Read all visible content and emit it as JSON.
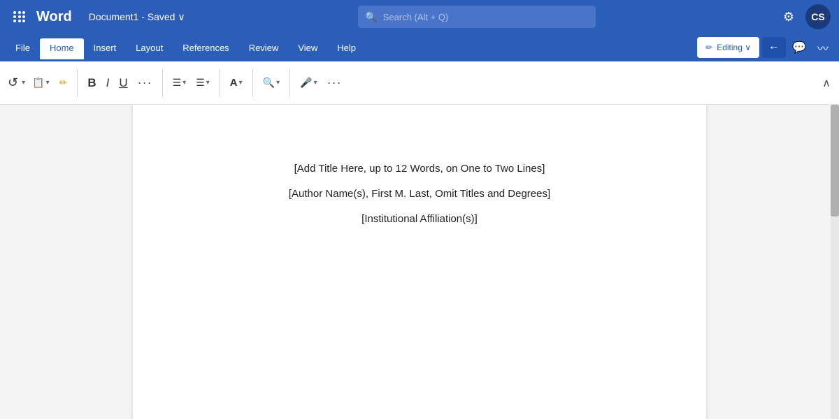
{
  "titlebar": {
    "grid_icon": "⋮⋮⋮",
    "app_name": "Word",
    "doc_title": "Document1  -  Saved  ∨",
    "search_placeholder": "Search (Alt + Q)",
    "settings_icon": "⚙",
    "avatar_initials": "CS"
  },
  "menubar": {
    "items": [
      {
        "label": "File",
        "active": false
      },
      {
        "label": "Home",
        "active": true
      },
      {
        "label": "Insert",
        "active": false
      },
      {
        "label": "Layout",
        "active": false
      },
      {
        "label": "References",
        "active": false
      },
      {
        "label": "Review",
        "active": false
      },
      {
        "label": "View",
        "active": false
      },
      {
        "label": "Help",
        "active": false
      }
    ],
    "edit_btn_label": "✏ Editing ∨",
    "share_icon": "↑",
    "comment_icon": "💬",
    "activity_icon": "~"
  },
  "ribbon": {
    "undo": "↺",
    "undo_dropdown": "∨",
    "redo": "↻",
    "clipboard": "📋",
    "clipboard_dropdown": "∨",
    "format_painter": "✏",
    "bold": "B",
    "italic": "I",
    "underline": "U",
    "more": "···",
    "list_bullet": "≡",
    "list_bullet_dropdown": "∨",
    "list_align": "≡",
    "list_align_dropdown": "∨",
    "font_color": "A",
    "font_color_dropdown": "∨",
    "find": "🔍",
    "find_dropdown": "∨",
    "mic": "🎤",
    "mic_dropdown": "∨",
    "extra": "···",
    "collapse": "∧"
  },
  "document": {
    "lines": [
      "[Add Title Here, up to 12 Words, on One to Two Lines]",
      "[Author Name(s), First M. Last, Omit Titles and Degrees]",
      "[Institutional Affiliation(s)]"
    ]
  }
}
